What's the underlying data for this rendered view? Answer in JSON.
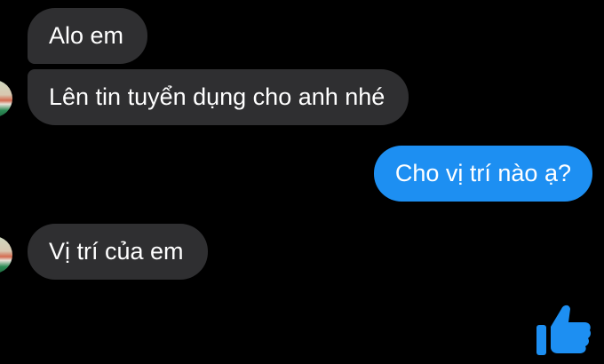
{
  "conversation": {
    "messages": [
      {
        "direction": "incoming",
        "text": "Alo em"
      },
      {
        "direction": "incoming",
        "text": "Lên tin tuyển dụng cho anh nhé"
      },
      {
        "direction": "outgoing",
        "text": "Cho vị trí nào ạ?"
      },
      {
        "direction": "incoming",
        "text": "Vị trí của em"
      }
    ]
  },
  "composer": {
    "like_icon": "thumbs-up-icon"
  },
  "colors": {
    "background": "#000000",
    "incoming_bubble": "#2f2f31",
    "outgoing_bubble": "#1d8ff2",
    "text": "#ffffff"
  }
}
